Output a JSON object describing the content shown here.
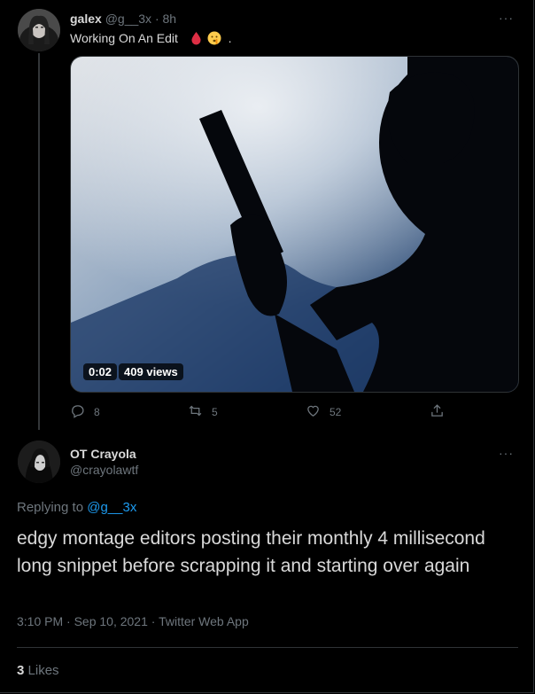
{
  "parent_tweet": {
    "author_name": "galex",
    "handle": "@g__3x",
    "separator": "·",
    "time": "8h",
    "more": "···",
    "text": "Working On An Edit",
    "text_suffix": ".",
    "video": {
      "duration": "0:02",
      "views": "409 views"
    },
    "actions": {
      "replies": "8",
      "retweets": "5",
      "likes": "52"
    }
  },
  "reply_tweet": {
    "author_name": "OT Crayola",
    "handle": "@crayolawtf",
    "more": "···",
    "replying_prefix": "Replying to",
    "replying_to": "@g__3x",
    "text": "edgy montage editors posting their monthly 4 millisecond long snippet before scrapping it and starting over again",
    "meta": "3:10 PM · Sep 10, 2021 · Twitter Web App",
    "like_count": "3",
    "like_label": "Likes"
  },
  "icons": {
    "reply": "reply-icon",
    "retweet": "retweet-icon",
    "like": "heart-icon",
    "share": "share-icon",
    "emoji_drop": "drop-emoji-icon",
    "emoji_face": "shushing-face-emoji-icon"
  }
}
